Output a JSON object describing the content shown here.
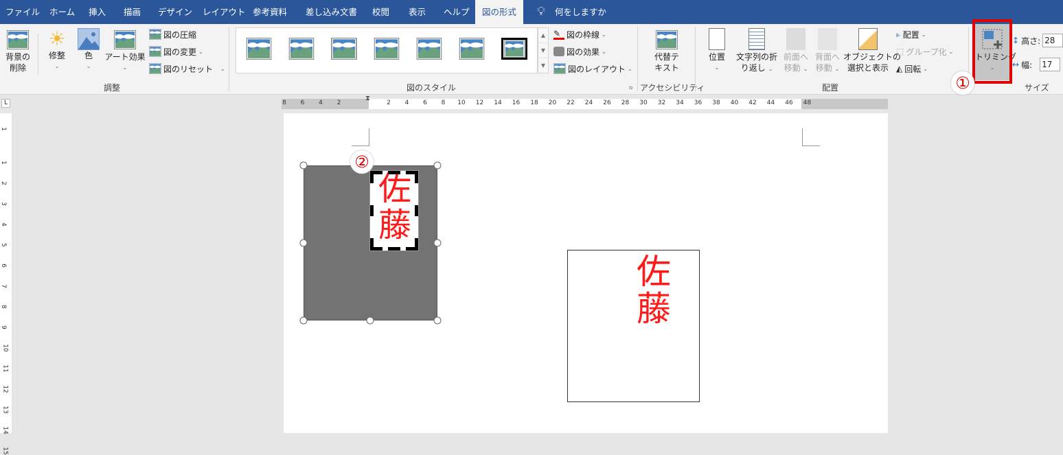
{
  "tabs": [
    "ファイル",
    "ホーム",
    "挿入",
    "描画",
    "デザイン",
    "レイアウト",
    "参考資料",
    "差し込み文書",
    "校閲",
    "表示",
    "ヘルプ",
    "図の形式"
  ],
  "tell_me": "何をしますか",
  "ribbon": {
    "adjust": {
      "remove_bg": "背景の",
      "remove_bg2": "削除",
      "corrections": "修整",
      "color": "色",
      "artistic": "アート効果",
      "compress": "図の圧縮",
      "change": "図の変更",
      "reset": "図のリセット",
      "label": "調整"
    },
    "styles": {
      "border": "図の枠線",
      "effects": "図の効果",
      "layout": "図のレイアウト",
      "label": "図のスタイル"
    },
    "access": {
      "alt1": "代替テ",
      "alt2": "キスト",
      "label": "アクセシビリティ"
    },
    "arrange": {
      "position": "位置",
      "wrap1": "文字列の折",
      "wrap2": "り返し",
      "fwd1": "前面へ",
      "fwd2": "移動",
      "back1": "背面へ",
      "back2": "移動",
      "sel1": "オブジェクトの",
      "sel2": "選択と表示",
      "align": "配置",
      "group": "グループ化",
      "rotate": "回転",
      "label": "配置"
    },
    "size": {
      "crop": "トリミング",
      "height_label": "高さ:",
      "height_value": "28",
      "width_label": "幅:",
      "width_value": "17",
      "label": "サイズ"
    }
  },
  "callouts": [
    "①",
    "②"
  ],
  "ruler": {
    "left": [
      "8",
      "6",
      "4",
      "2"
    ],
    "right": [
      "2",
      "4",
      "6",
      "8",
      "10",
      "12",
      "14",
      "16",
      "18",
      "20",
      "22",
      "24",
      "26",
      "28",
      "30",
      "32",
      "34",
      "36",
      "38",
      "40",
      "42",
      "44",
      "46",
      "48"
    ],
    "vertical": [
      "1",
      "1",
      "2",
      "3",
      "4",
      "5",
      "6",
      "7",
      "8",
      "9",
      "10",
      "11",
      "12",
      "13",
      "14",
      "15"
    ],
    "corner": "L"
  },
  "document": {
    "seal_top": "佐",
    "seal_bottom": "藤"
  },
  "colors": {
    "tabbar": "#2b579a",
    "highlight": "#e00000",
    "seal": "#ff1a1a"
  }
}
